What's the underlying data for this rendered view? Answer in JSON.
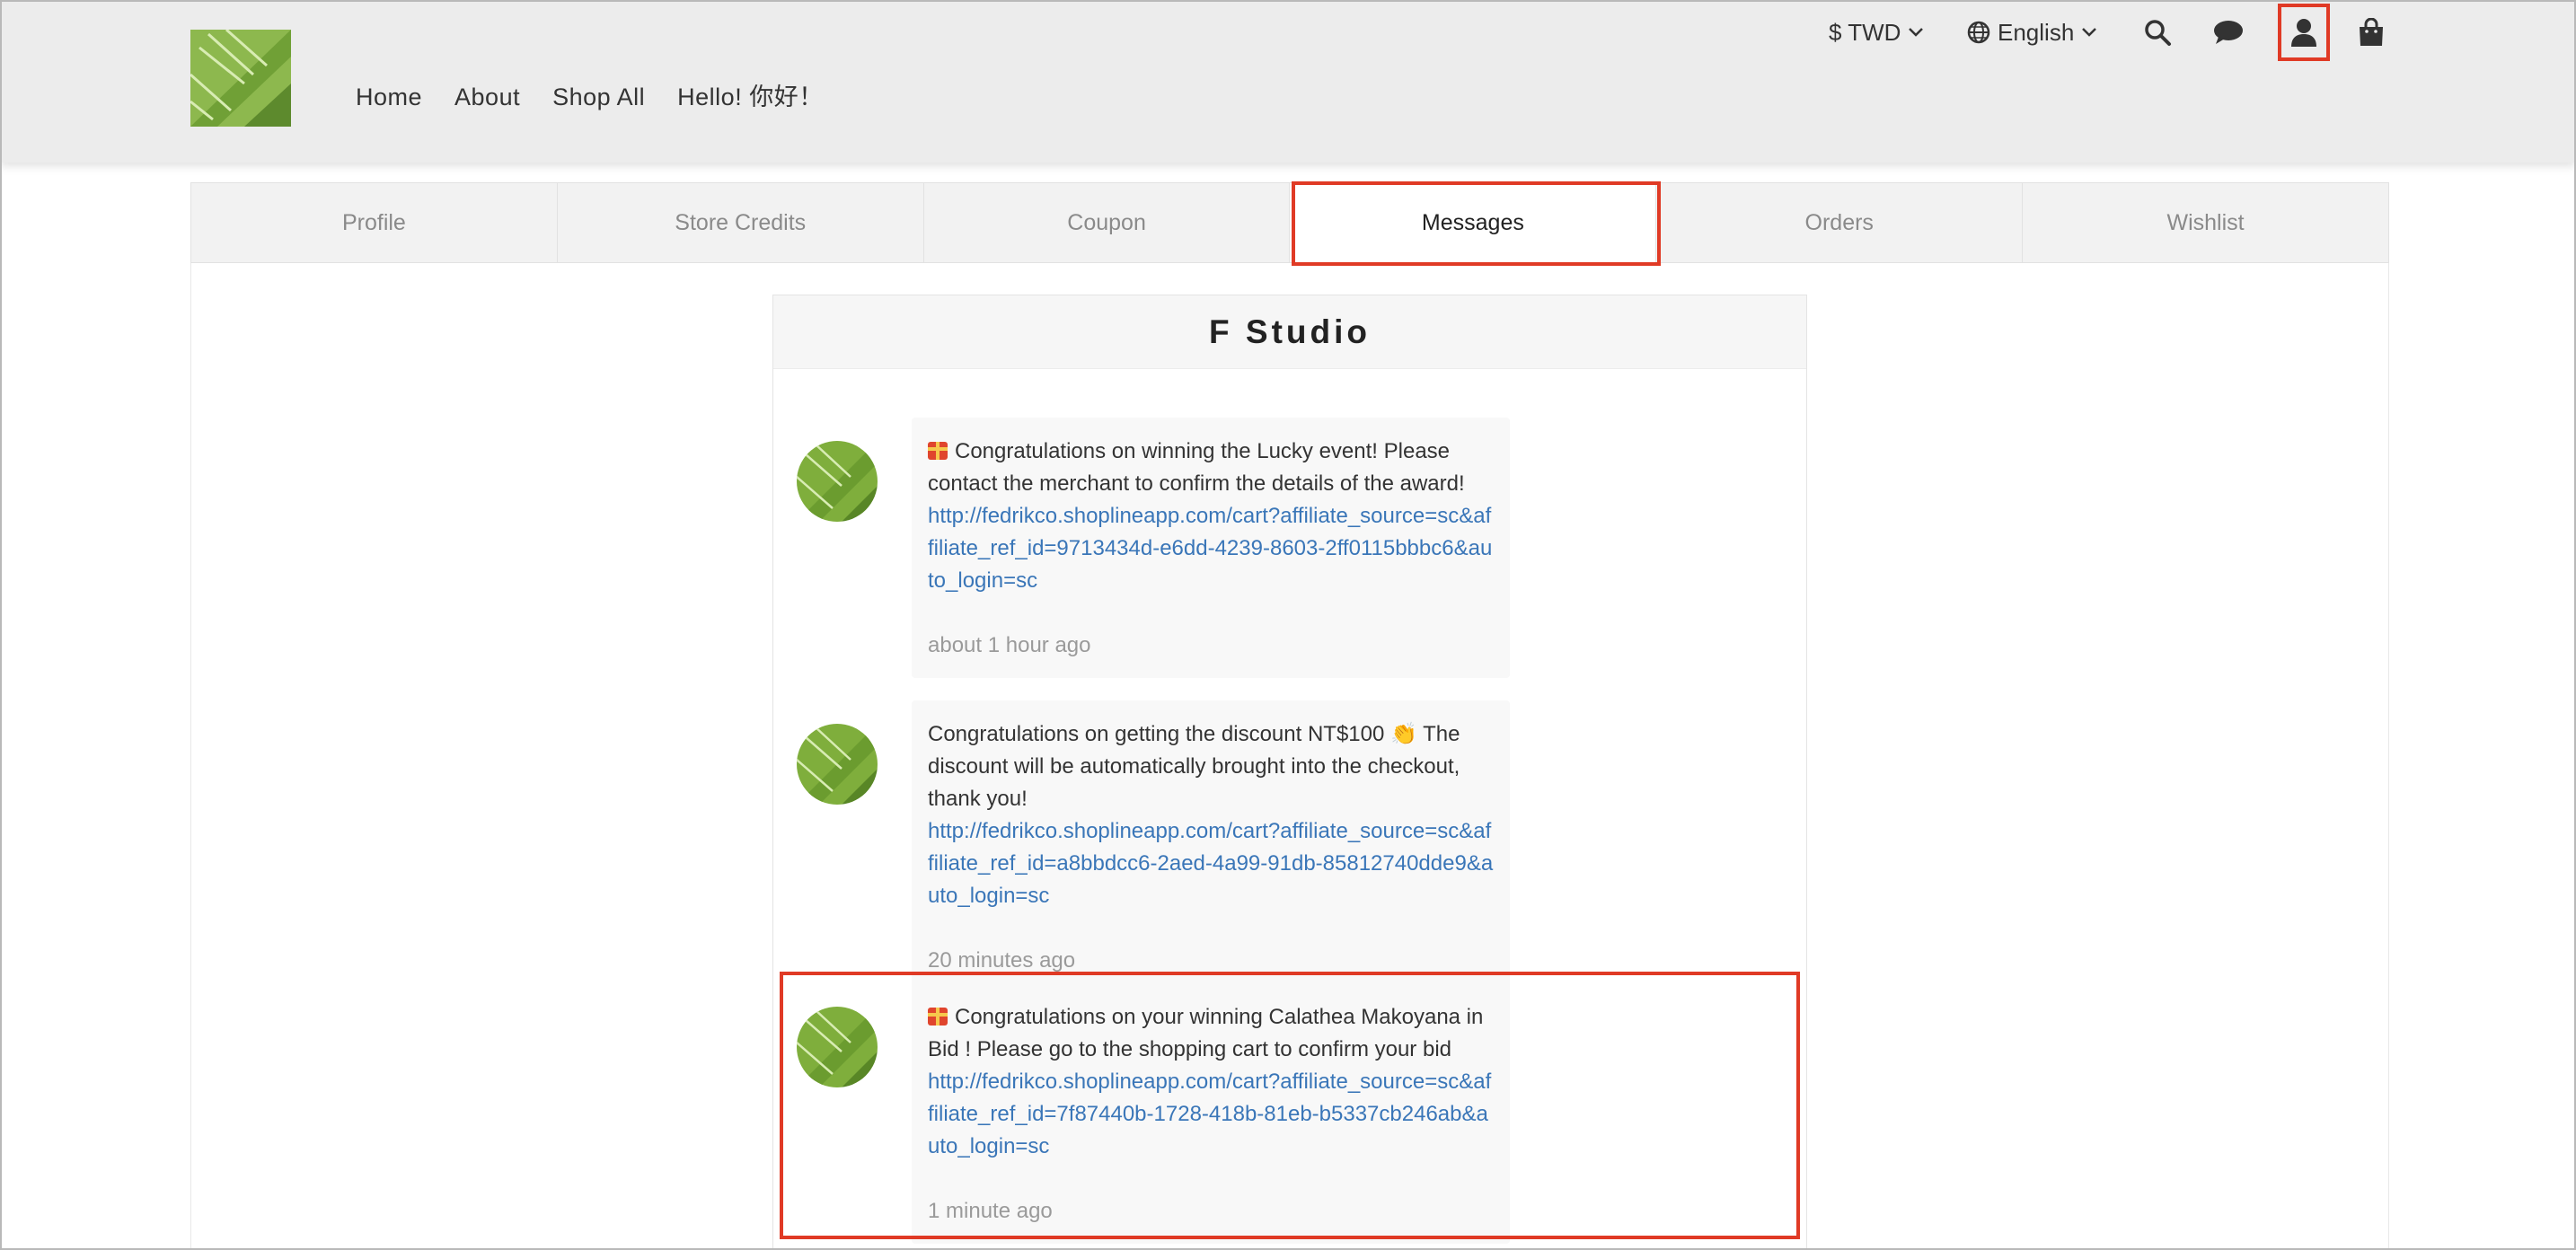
{
  "header": {
    "nav": [
      "Home",
      "About",
      "Shop All",
      "Hello! 你好！"
    ],
    "currency": "$ TWD",
    "language": "English"
  },
  "tabs": [
    "Profile",
    "Store Credits",
    "Coupon",
    "Messages",
    "Orders",
    "Wishlist"
  ],
  "active_tab": "Messages",
  "store_name": "F Studio",
  "messages": [
    {
      "text": "Congratulations on winning the Lucky  event! Please contact the merchant to confirm the details of the award!",
      "link": "http://fedrikco.shoplineapp.com/cart?affiliate_source=sc&affiliate_ref_id=9713434d-e6dd-4239-8603-2ff0115bbbc6&auto_login=sc",
      "time": "about 1 hour ago"
    },
    {
      "text": "Congratulations on getting the discount NT$100 👏 The discount will be automatically brought into the checkout, thank you!",
      "link": "http://fedrikco.shoplineapp.com/cart?affiliate_source=sc&affiliate_ref_id=a8bbdcc6-2aed-4a99-91db-85812740dde9&auto_login=sc",
      "time": "20 minutes ago"
    },
    {
      "text": "Congratulations on your winning Calathea Makoyana in Bid ! Please go to the shopping cart to confirm your bid",
      "link": "http://fedrikco.shoplineapp.com/cart?affiliate_source=sc&affiliate_ref_id=7f87440b-1728-418b-81eb-b5337cb246ab&auto_login=sc",
      "time": "1 minute ago"
    }
  ],
  "colors": {
    "highlight": "#e03a25",
    "link": "#3a76b8",
    "header_bg": "#ececec"
  }
}
